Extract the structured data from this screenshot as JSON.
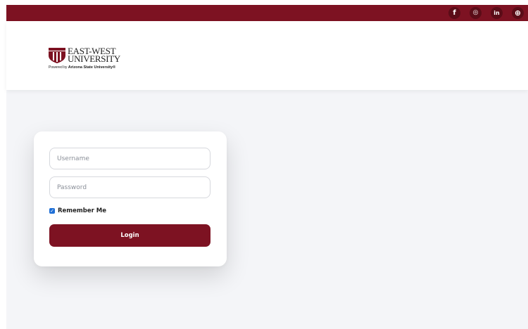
{
  "colors": {
    "brand": "#7d1222",
    "page_bg": "#f4f5f8",
    "checkbox": "#1f6fd6"
  },
  "social": [
    {
      "icon": "facebook-icon",
      "glyph": "f"
    },
    {
      "icon": "instagram-icon",
      "glyph": "◎"
    },
    {
      "icon": "linkedin-icon",
      "glyph": "in"
    },
    {
      "icon": "globe-icon",
      "glyph": "⊕"
    }
  ],
  "logo": {
    "line1": "EAST-WEST",
    "line2": "UNIVERSITY",
    "powered_prefix": "Powered by ",
    "powered_by": "Arizona State University®"
  },
  "login": {
    "username_placeholder": "Username",
    "password_placeholder": "Password",
    "remember_label": "Remember Me",
    "remember_checked": true,
    "button_label": "Login"
  }
}
